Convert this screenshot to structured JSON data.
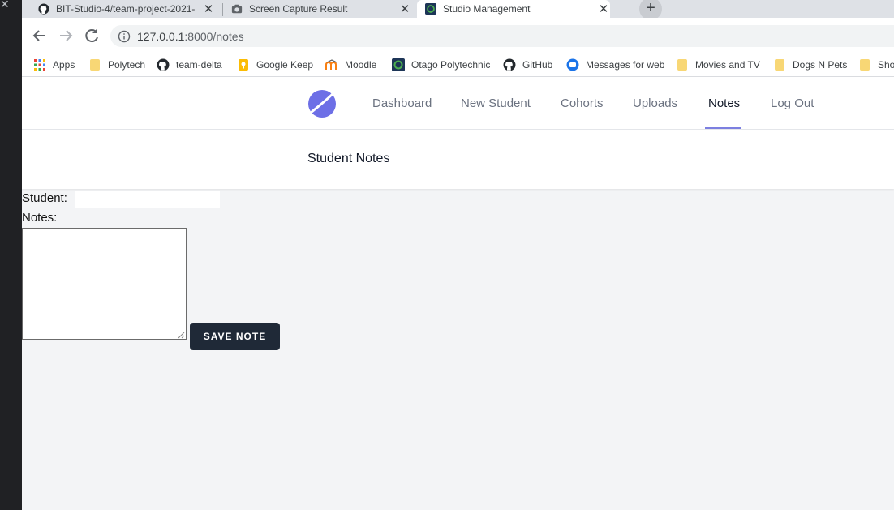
{
  "browser": {
    "tabs": [
      {
        "title": "BIT-Studio-4/team-project-2021-",
        "icon": "github-icon",
        "active": false
      },
      {
        "title": "Screen Capture Result",
        "icon": "camera-icon",
        "active": false
      },
      {
        "title": "Studio Management",
        "icon": "studio-favicon",
        "active": true
      }
    ],
    "new_tab_label": "+",
    "url": {
      "host": "127.0.0.1",
      "rest": ":8000/notes"
    },
    "bookmarks": [
      {
        "label": "Apps",
        "icon": "apps-grid-icon"
      },
      {
        "label": "Polytech",
        "icon": "folder-icon"
      },
      {
        "label": "team-delta",
        "icon": "github-icon"
      },
      {
        "label": "Google Keep",
        "icon": "keep-icon"
      },
      {
        "label": "Moodle",
        "icon": "moodle-icon"
      },
      {
        "label": "Otago Polytechnic",
        "icon": "otago-icon"
      },
      {
        "label": "GitHub",
        "icon": "github-icon"
      },
      {
        "label": "Messages for web",
        "icon": "messages-icon"
      },
      {
        "label": "Movies and TV",
        "icon": "folder-icon"
      },
      {
        "label": "Dogs N Pets",
        "icon": "folder-icon"
      },
      {
        "label": "Sho",
        "icon": "folder-icon"
      }
    ]
  },
  "nav": {
    "links": [
      "Dashboard",
      "New Student",
      "Cohorts",
      "Uploads",
      "Notes",
      "Log Out"
    ],
    "active": "Notes",
    "accent": "#7c7fe0"
  },
  "header": {
    "title": "Student Notes"
  },
  "form": {
    "student_label": "Student:",
    "student_value": "",
    "notes_label": "Notes:",
    "notes_value": "",
    "save_label": "Save Note",
    "button_color": "#1f2937"
  }
}
